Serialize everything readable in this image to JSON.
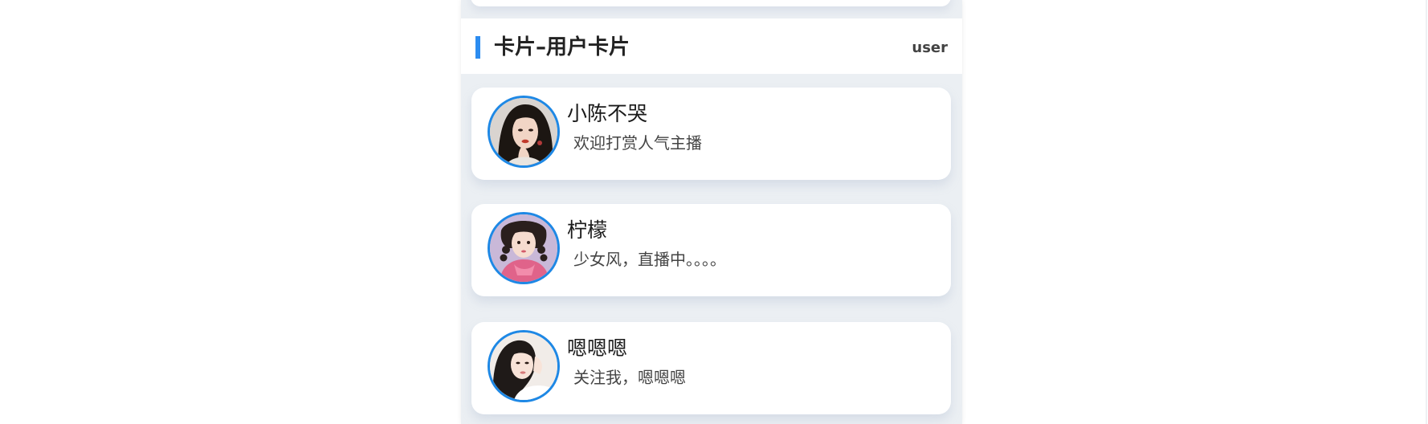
{
  "section": {
    "title": "卡片–用户卡片",
    "tag": "user"
  },
  "users": [
    {
      "name": "小陈不哭",
      "desc": "欢迎打赏人气主播",
      "avatar": "woman-portrait-dark-hair"
    },
    {
      "name": "柠檬",
      "desc": "少女风，直播中。。。。",
      "avatar": "woman-portrait-braids-pink"
    },
    {
      "name": "嗯嗯嗯",
      "desc": "关注我，嗯嗯嗯",
      "avatar": "woman-portrait-light"
    }
  ],
  "colors": {
    "accent": "#2c8cf0",
    "avatar_border": "#1e88e5",
    "panel_bg": "#ebeff3"
  }
}
